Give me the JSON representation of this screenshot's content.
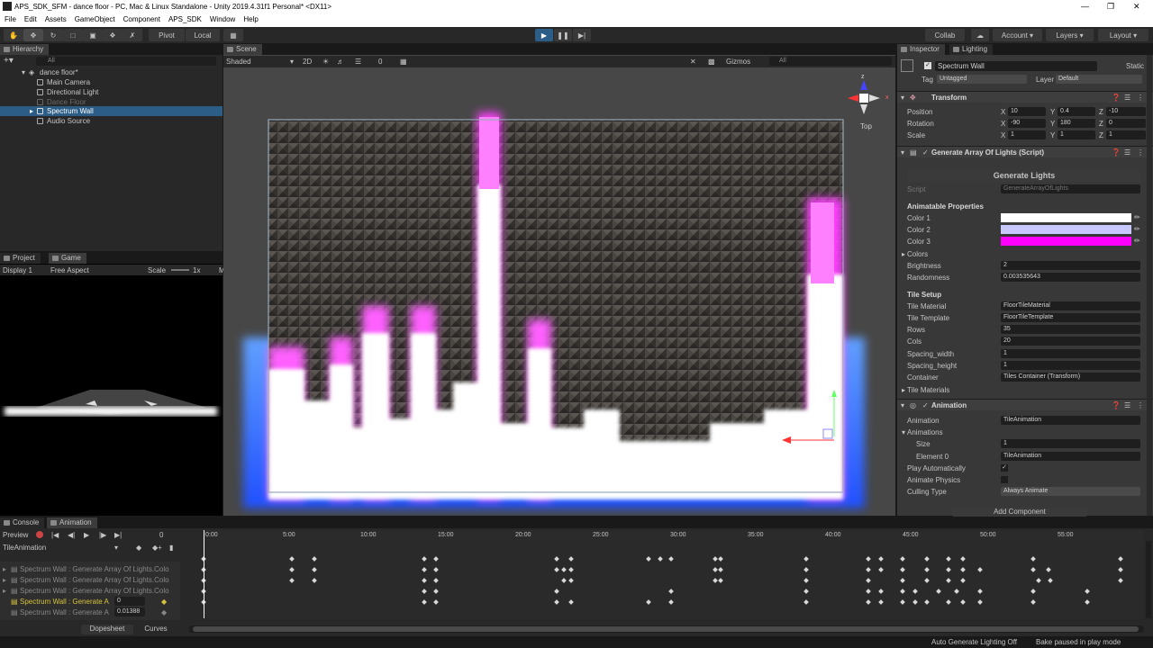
{
  "window": {
    "title": "APS_SDK_SFM - dance floor - PC, Mac & Linux Standalone - Unity 2019.4.31f1 Personal* <DX11>"
  },
  "menu": [
    "File",
    "Edit",
    "Assets",
    "GameObject",
    "Component",
    "APS_SDK",
    "Window",
    "Help"
  ],
  "toolbar": {
    "pivot": "Pivot",
    "local": "Local",
    "collab": "Collab",
    "account": "Account",
    "layers": "Layers",
    "layout": "Layout"
  },
  "hierarchy": {
    "tab": "Hierarchy",
    "search": "All",
    "scene": "dance floor*",
    "items": [
      "Main Camera",
      "Directional Light",
      "Dance Floor",
      "Spectrum Wall",
      "Audio Source"
    ],
    "selected": "Spectrum Wall"
  },
  "game": {
    "tabs": [
      "Project",
      "Game"
    ],
    "display": "Display 1",
    "aspect": "Free Aspect",
    "scale_label": "Scale",
    "scale_value": "1x",
    "extra": "M"
  },
  "scene": {
    "tab": "Scene",
    "shading": "Shaded",
    "mode2d": "2D",
    "hidden_count": "0",
    "gizmos": "Gizmos",
    "search": "All",
    "view": "Top"
  },
  "inspector": {
    "tabs": [
      "Inspector",
      "Lighting"
    ],
    "name": "Spectrum Wall",
    "static": "Static",
    "tag_label": "Tag",
    "tag": "Untagged",
    "layer_label": "Layer",
    "layer": "Default",
    "transform": {
      "title": "Transform",
      "rows": [
        {
          "label": "Position",
          "x": "10",
          "y": "0.4",
          "z": "-10"
        },
        {
          "label": "Rotation",
          "x": "-90",
          "y": "180",
          "z": "0"
        },
        {
          "label": "Scale",
          "x": "1",
          "y": "1",
          "z": "1"
        }
      ]
    },
    "script": {
      "title": "Generate Array Of Lights (Script)",
      "button": "Generate Lights",
      "script_label": "Script",
      "script_value": "GenerateArrayOfLights",
      "animatable": "Animatable Properties",
      "colors": [
        {
          "label": "Color 1",
          "hex": "#ffffff"
        },
        {
          "label": "Color 2",
          "hex": "#c8c8ff"
        },
        {
          "label": "Color 3",
          "hex": "#ff00ff"
        }
      ],
      "colors_fold": "Colors",
      "brightness_label": "Brightness",
      "brightness": "2",
      "randomness_label": "Randomness",
      "randomness": "0.003535643",
      "tile_setup": "Tile Setup",
      "fields": [
        {
          "label": "Tile Material",
          "value": "FloorTileMaterial"
        },
        {
          "label": "Tile Template",
          "value": "FloorTileTemplate"
        },
        {
          "label": "Rows",
          "value": "35"
        },
        {
          "label": "Cols",
          "value": "20"
        },
        {
          "label": "Spacing_width",
          "value": "1"
        },
        {
          "label": "Spacing_height",
          "value": "1"
        },
        {
          "label": "Container",
          "value": "Tiles Container (Transform)"
        }
      ],
      "tile_materials": "Tile Materials"
    },
    "animation": {
      "title": "Animation",
      "rows": [
        {
          "label": "Animation",
          "value": "TileAnimation"
        },
        {
          "label": "Animations",
          "value": ""
        },
        {
          "label": "Size",
          "value": "1"
        },
        {
          "label": "Element 0",
          "value": "TileAnimation"
        },
        {
          "label": "Play Automatically",
          "value": ""
        },
        {
          "label": "Animate Physics",
          "value": ""
        },
        {
          "label": "Culling Type",
          "value": "Always Animate"
        }
      ]
    },
    "add_component": "Add Component"
  },
  "animation_window": {
    "tabs": [
      "Console",
      "Animation"
    ],
    "preview": "Preview",
    "frame": "0",
    "clip": "TileAnimation",
    "ruler": [
      "0:00",
      "5:00",
      "10:00",
      "15:00",
      "20:00",
      "25:00",
      "30:00",
      "35:00",
      "40:00",
      "45:00",
      "50:00",
      "55:00"
    ],
    "tracks": [
      {
        "name": "Spectrum Wall : Generate Array Of Lights.Colo",
        "value": ""
      },
      {
        "name": "Spectrum Wall : Generate Array Of Lights.Colo",
        "value": ""
      },
      {
        "name": "Spectrum Wall : Generate Array Of Lights.Colo",
        "value": ""
      },
      {
        "name": "Spectrum Wall : Generate A",
        "value": "0"
      },
      {
        "name": "Spectrum Wall : Generate A",
        "value": "0.01388"
      }
    ],
    "bottom_tabs": [
      "Dopesheet",
      "Curves"
    ]
  },
  "statusbar": {
    "left": "Auto Generate Lighting Off",
    "right": "Bake paused in play mode"
  },
  "colors": {
    "accent": "#2c5d87",
    "magenta": "#ff40ff",
    "bg": "#282828"
  }
}
